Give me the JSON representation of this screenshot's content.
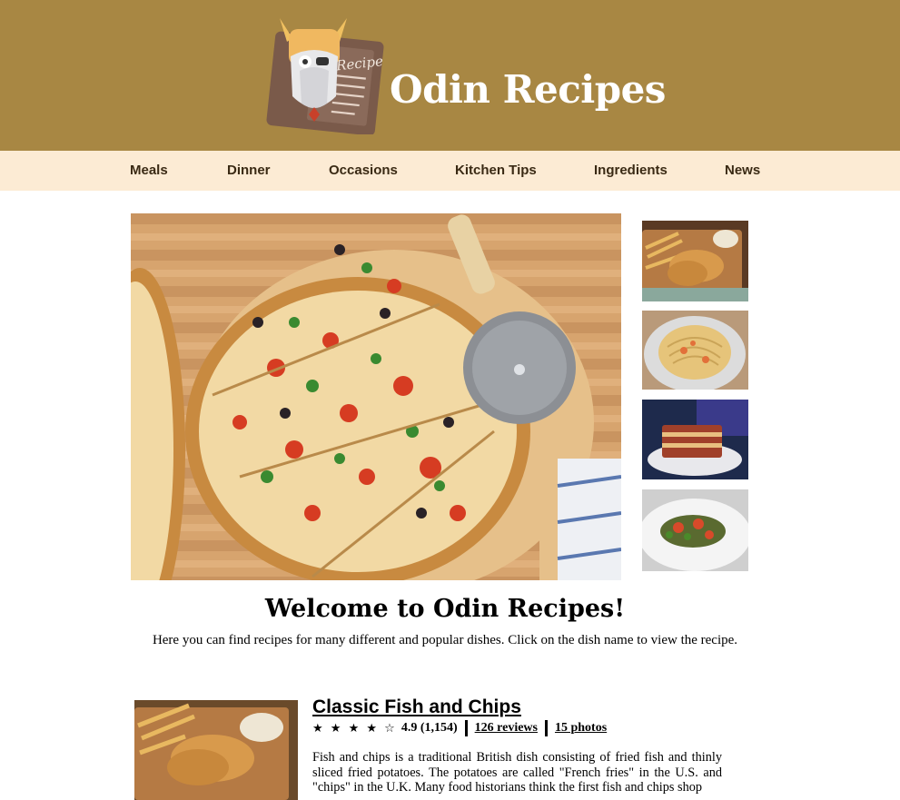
{
  "header": {
    "title": "Odin Recipes",
    "logo_text": "Recipe",
    "background": "#a88743"
  },
  "nav": {
    "background": "#fcebd4",
    "items": [
      "Meals",
      "Dinner",
      "Occasions",
      "Kitchen Tips",
      "Ingredients",
      "News"
    ]
  },
  "hero": {
    "icon": "pizza-photo"
  },
  "thumbnails": [
    "fish-and-chips-photo",
    "pasta-photo",
    "lasagna-photo",
    "ratatouille-photo"
  ],
  "welcome": {
    "heading": "Welcome to Odin Recipes!",
    "intro": "Here you can find recipes for many different and popular dishes. Click on the dish name to view the recipe."
  },
  "recipe": {
    "title": "Classic Fish and Chips",
    "stars": "★ ★ ★ ★ ☆",
    "rating": "4.9 (1,154)",
    "reviews": "126 reviews",
    "photos": "15 photos",
    "description": "Fish and chips is a traditional British dish consisting of fried fish and thinly sliced fried potatoes. The potatoes are called \"French fries\" in the U.S. and \"chips\" in the U.K. Many food historians think the first fish and chips shop"
  }
}
